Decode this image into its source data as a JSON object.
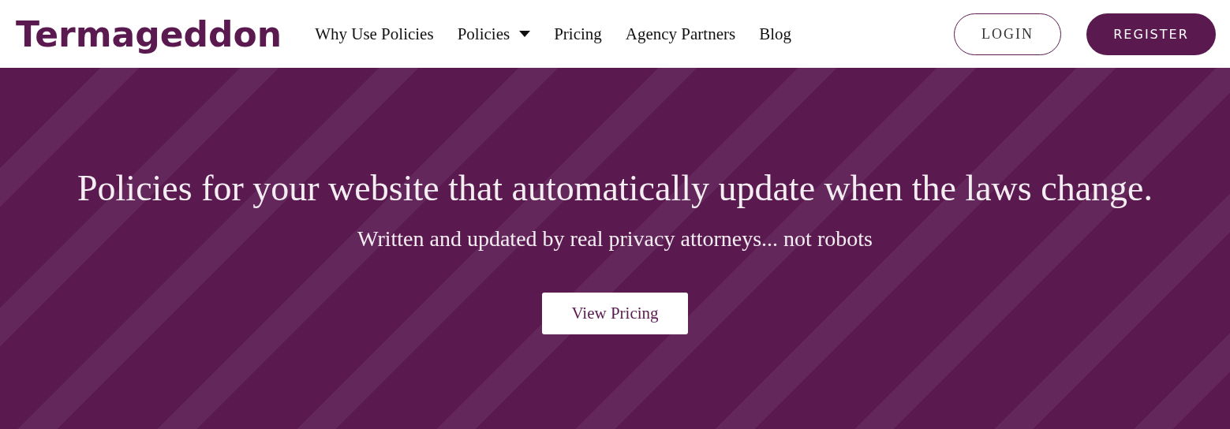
{
  "header": {
    "logo": "Termageddon",
    "nav": [
      {
        "label": "Why Use Policies",
        "has_dropdown": false
      },
      {
        "label": "Policies",
        "has_dropdown": true
      },
      {
        "label": "Pricing",
        "has_dropdown": false
      },
      {
        "label": "Agency Partners",
        "has_dropdown": false
      },
      {
        "label": "Blog",
        "has_dropdown": false
      }
    ],
    "login": "LOGIN",
    "register": "REGISTER"
  },
  "hero": {
    "title": "Policies for your website that automatically update when the laws change.",
    "subtitle": "Written and updated by real privacy attorneys... not robots",
    "cta": "View Pricing"
  }
}
